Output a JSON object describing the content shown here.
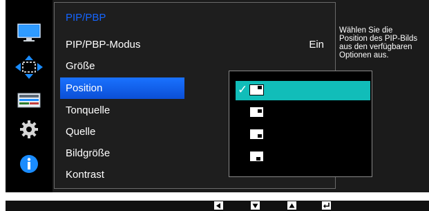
{
  "menu": {
    "title": "PIP/PBP",
    "items": [
      {
        "label": "PIP/PBP-Modus",
        "value": "Ein"
      },
      {
        "label": "Größe",
        "value": ""
      },
      {
        "label": "Position",
        "value": ""
      },
      {
        "label": "Tonquelle",
        "value": ""
      },
      {
        "label": "Quelle",
        "value": ""
      },
      {
        "label": "Bildgröße",
        "value": ""
      },
      {
        "label": "Kontrast",
        "value": ""
      }
    ],
    "selected_index": 2
  },
  "categories": [
    "picture-icon",
    "position-arrows-icon",
    "pip-icon",
    "gear-icon",
    "info-icon"
  ],
  "submenu": {
    "options": [
      "top-right",
      "bottom-right",
      "bottom-left",
      "top-left"
    ],
    "selected_index": 0
  },
  "description": "Wählen Sie die\nPosition des PIP-Bilds\naus den verfügbaren\nOptionen aus.",
  "bottom_buttons": [
    "left-button-icon",
    "down-button-icon",
    "up-button-icon",
    "enter-button-icon"
  ],
  "colors": {
    "accent_blue": "#1565ff",
    "selection_teal": "#11bdb9",
    "info_blue": "#1a8cff"
  }
}
